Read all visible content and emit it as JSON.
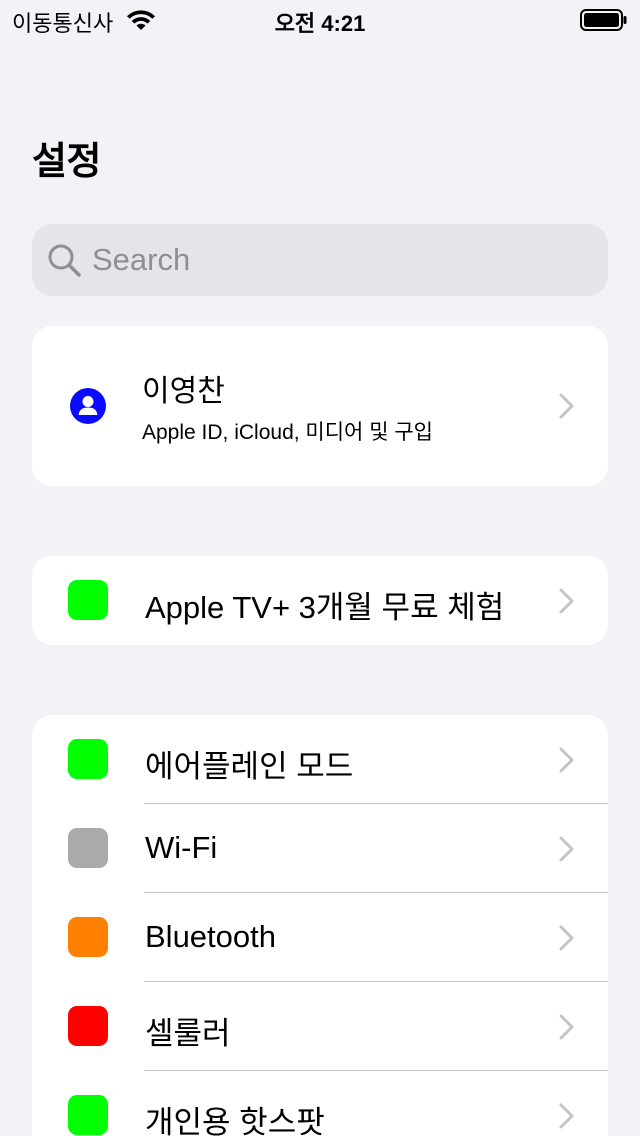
{
  "status_bar": {
    "carrier": "이동통신사",
    "time": "오전 4:21"
  },
  "header": {
    "title": "설정"
  },
  "search": {
    "placeholder": "Search"
  },
  "profile": {
    "name": "이영찬",
    "subtitle": "Apple ID, iCloud, 미디어 및 구입",
    "avatar_color": "#0a0aff"
  },
  "promo": {
    "label": "Apple TV+ 3개월 무료 체험",
    "icon_color": "#00ff00"
  },
  "settings": {
    "items": [
      {
        "label": "에어플레인 모드",
        "icon_color": "#00ff00"
      },
      {
        "label": "Wi-Fi",
        "icon_color": "#aaaaaa"
      },
      {
        "label": "Bluetooth",
        "icon_color": "#ff8000"
      },
      {
        "label": "셀룰러",
        "icon_color": "#ff0000"
      },
      {
        "label": "개인용 핫스팟",
        "icon_color": "#00ff00"
      }
    ]
  },
  "colors": {
    "background": "#f2f2f7",
    "card": "#ffffff",
    "chevron": "#c4c4c7",
    "separator": "#c6c6c8"
  }
}
